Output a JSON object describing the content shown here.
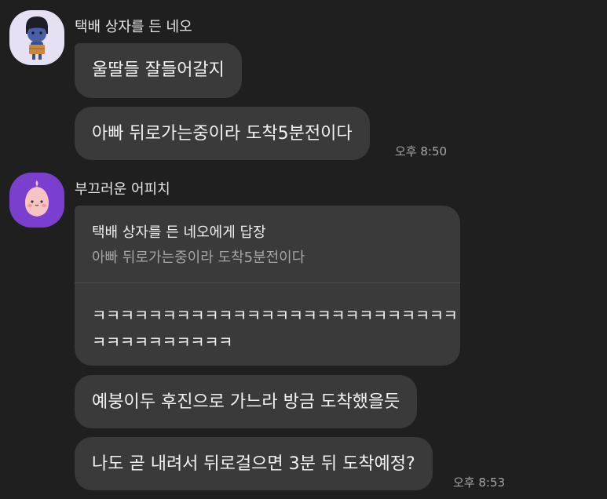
{
  "messages": {
    "neo": {
      "sender": "택배 상자를 든 네오",
      "bubbles": [
        "울딸들 잘들어갈지",
        "아빠 뒤로가는중이라 도착5분전이다"
      ],
      "time": "오후 8:50"
    },
    "apeach": {
      "sender": "부끄러운 어피치",
      "reply": {
        "reply_to": "택배 상자를 든 네오에게 답장",
        "quoted_text": "아빠 뒤로가는중이라 도착5분전이다",
        "body_line1": "ㅋㅋㅋㅋㅋㅋㅋㅋㅋㅋㅋㅋㅋㅋㅋㅋㅋㅋㅋㅋㅋㅋㅋㅋㅋㅋ",
        "body_line2": "ㅋㅋㅋㅋㅋㅋㅋㅋㅋㅋ"
      },
      "bubbles": [
        "예붕이두 후진으로 가느라 방금 도착했을듯",
        "나도 곧 내려서 뒤로걸으면 3분 뒤 도착예정?"
      ],
      "time": "오후 8:53"
    }
  },
  "colors": {
    "background": "#1f1f1f",
    "bubble": "#3a3a3a",
    "neo_avatar_bg": "#e6e0f5",
    "apeach_avatar_bg": "#7b3fd0"
  }
}
